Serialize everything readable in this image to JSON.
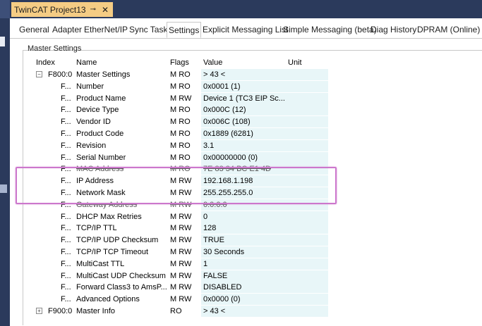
{
  "window": {
    "doc_tab_title": "TwinCAT Project13",
    "pin_glyph": "⊸",
    "close_glyph": "✕"
  },
  "tabs": [
    "General",
    "Adapter",
    "EtherNet/IP",
    "Sync Task",
    "Settings",
    "Explicit Messaging List",
    "Simple Messaging (beta)",
    "Diag History",
    "DPRAM (Online)"
  ],
  "active_tab": "Settings",
  "group": {
    "label": "Master Settings"
  },
  "columns": {
    "index": "Index",
    "name": "Name",
    "flags": "Flags",
    "value": "Value",
    "unit": "Unit"
  },
  "rows": [
    {
      "index": "F800:0",
      "name": "Master Settings",
      "flags": "M RO",
      "value": "> 43 <",
      "expander": "−",
      "level": 0
    },
    {
      "index": "F...",
      "name": "Number",
      "flags": "M RO",
      "value": "0x0001 (1)",
      "level": 1
    },
    {
      "index": "F...",
      "name": "Product Name",
      "flags": "M RW",
      "value": "Device 1 (TC3 EIP Sc...",
      "level": 1
    },
    {
      "index": "F...",
      "name": "Device Type",
      "flags": "M RO",
      "value": "0x000C (12)",
      "level": 1
    },
    {
      "index": "F...",
      "name": "Vendor ID",
      "flags": "M RO",
      "value": "0x006C (108)",
      "level": 1
    },
    {
      "index": "F...",
      "name": "Product Code",
      "flags": "M RO",
      "value": "0x1889 (6281)",
      "level": 1
    },
    {
      "index": "F...",
      "name": "Revision",
      "flags": "M RO",
      "value": "3.1",
      "level": 1
    },
    {
      "index": "F...",
      "name": "Serial Number",
      "flags": "M RO",
      "value": "0x00000000 (0)",
      "level": 1
    },
    {
      "index": "F...",
      "name": "MAC Address",
      "flags": "M RO",
      "value": "7E 83 34 BC E1 4D",
      "level": 1
    },
    {
      "index": "F...",
      "name": "IP Address",
      "flags": "M RW",
      "value": "192.168.1.198",
      "level": 1
    },
    {
      "index": "F...",
      "name": "Network Mask",
      "flags": "M RW",
      "value": "255.255.255.0",
      "level": 1
    },
    {
      "index": "F...",
      "name": "Gateway Address",
      "flags": "M RW",
      "value": "0.0.0.0",
      "level": 1
    },
    {
      "index": "F...",
      "name": "DHCP Max Retries",
      "flags": "M RW",
      "value": "0",
      "level": 1
    },
    {
      "index": "F...",
      "name": "TCP/IP TTL",
      "flags": "M RW",
      "value": "128",
      "level": 1
    },
    {
      "index": "F...",
      "name": "TCP/IP UDP Checksum",
      "flags": "M RW",
      "value": "TRUE",
      "level": 1
    },
    {
      "index": "F...",
      "name": "TCP/IP TCP Timeout",
      "flags": "M RW",
      "value": "30 Seconds",
      "level": 1
    },
    {
      "index": "F...",
      "name": "MultiCast TTL",
      "flags": "M RW",
      "value": "1",
      "level": 1
    },
    {
      "index": "F...",
      "name": "MultiCast UDP Checksum",
      "flags": "M RW",
      "value": "FALSE",
      "level": 1
    },
    {
      "index": "F...",
      "name": "Forward Class3 to AmsP...",
      "flags": "M RW",
      "value": "DISABLED",
      "level": 1
    },
    {
      "index": "F...",
      "name": "Advanced Options",
      "flags": "M RW",
      "value": "0x0000 (0)",
      "level": 1
    },
    {
      "index": "F900:0",
      "name": "Master Info",
      "flags": "RO",
      "value": "> 43 <",
      "expander": "+",
      "level": 0
    }
  ],
  "colors": {
    "title_bar": "#2b3a5c",
    "doc_tab": "#f5cc84",
    "value_bg": "#e8f6f8",
    "highlight": "#cc77cc"
  }
}
